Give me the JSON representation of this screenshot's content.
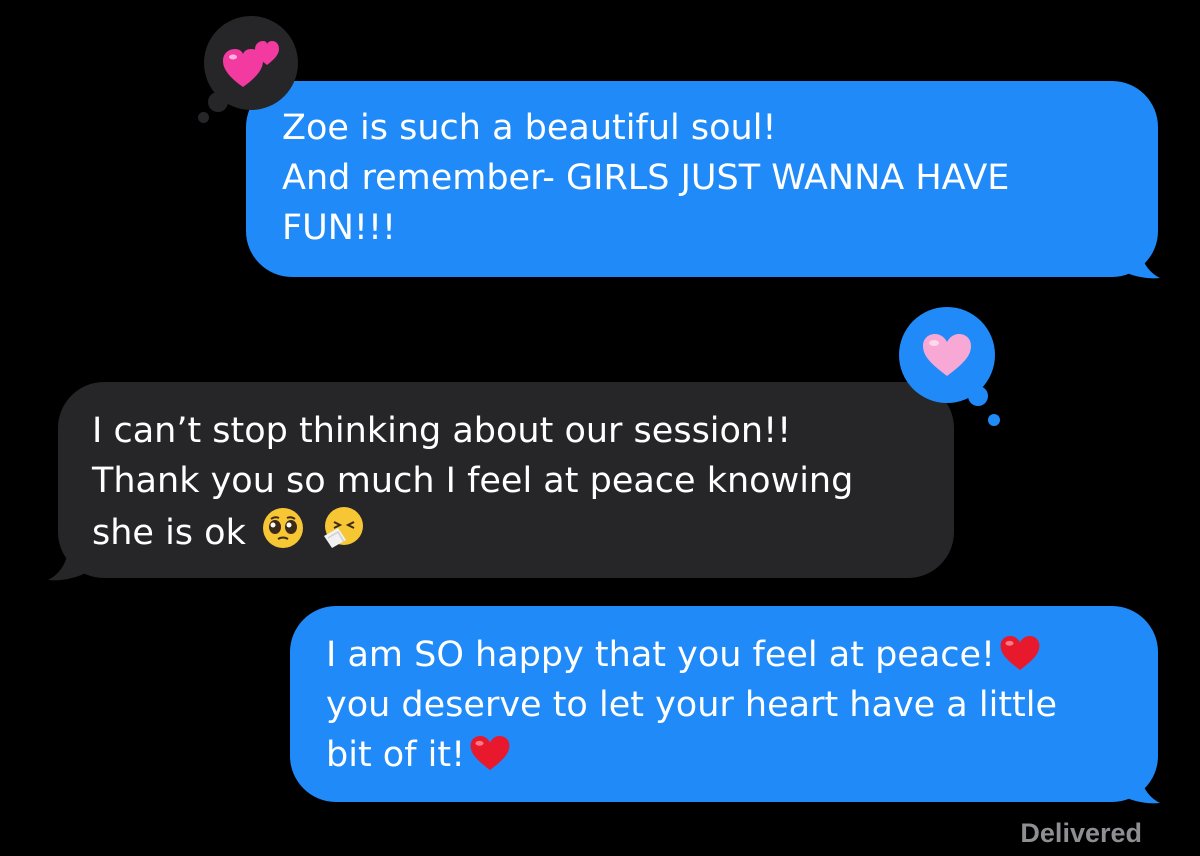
{
  "conversation": {
    "messages": [
      {
        "direction": "outgoing",
        "lines": [
          "Zoe is such a beautiful soul!",
          "And remember- GIRLS JUST WANNA HAVE",
          "FUN!!!"
        ],
        "reaction": {
          "icon": "two-hearts-icon",
          "side": "left"
        }
      },
      {
        "direction": "incoming",
        "lines": [
          "I can’t stop thinking about our session!!",
          "Thank you so much I feel at peace knowing",
          "she is ok"
        ],
        "trailing_icons": [
          "pleading-face-icon",
          "sneezing-face-icon"
        ],
        "reaction": {
          "icon": "pink-heart-icon",
          "side": "right"
        }
      },
      {
        "direction": "outgoing",
        "lines": [
          "I am SO happy that you feel at peace!",
          "you deserve to let your heart have a little",
          "bit of it!"
        ],
        "trailing_icons": [
          "red-heart-icon",
          "red-heart-icon"
        ]
      }
    ],
    "status": "Delivered"
  },
  "colors": {
    "background": "#000000",
    "outgoing_bubble": "#1f8af8",
    "incoming_bubble": "#262628",
    "status_text": "#8e8e93",
    "tapback_on_outgoing": "#262628",
    "tapback_on_incoming": "#1f8af8"
  }
}
